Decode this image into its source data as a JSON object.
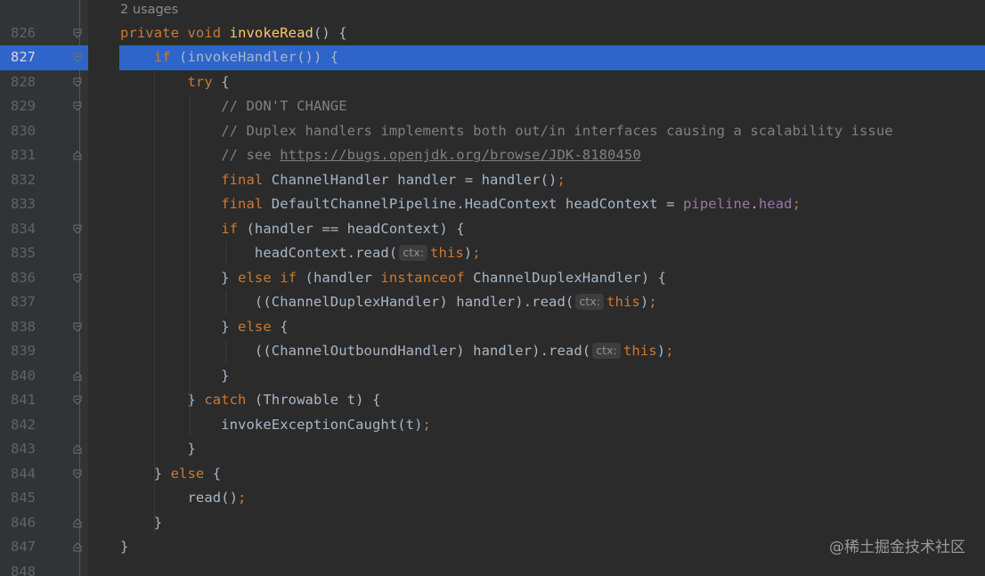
{
  "editor": {
    "usages_hint": "2 usages",
    "current_line": "827",
    "lines": [
      {
        "num": "826",
        "parts": [
          [
            "kw",
            "private "
          ],
          [
            "kw",
            "void "
          ],
          [
            "fn",
            "invokeRead"
          ],
          [
            "plain",
            "() {"
          ]
        ]
      },
      {
        "num": "827",
        "parts": [
          [
            "plain",
            "    "
          ],
          [
            "kw",
            "if "
          ],
          [
            "plain",
            "(invokeHandler()) {"
          ]
        ]
      },
      {
        "num": "828",
        "parts": [
          [
            "plain",
            "        "
          ],
          [
            "kw",
            "try "
          ],
          [
            "plain",
            "{"
          ]
        ]
      },
      {
        "num": "829",
        "parts": [
          [
            "plain",
            "            "
          ],
          [
            "cm",
            "// DON'T CHANGE"
          ]
        ]
      },
      {
        "num": "830",
        "parts": [
          [
            "plain",
            "            "
          ],
          [
            "cm",
            "// Duplex handlers implements both out/in interfaces causing a scalability issue"
          ]
        ]
      },
      {
        "num": "831",
        "parts": [
          [
            "plain",
            "            "
          ],
          [
            "cm",
            "// see "
          ],
          [
            "link",
            "https://bugs.openjdk.org/browse/JDK-8180450"
          ]
        ]
      },
      {
        "num": "832",
        "parts": [
          [
            "plain",
            "            "
          ],
          [
            "kw",
            "final "
          ],
          [
            "plain",
            "ChannelHandler handler = handler()"
          ],
          [
            "kw",
            ";"
          ]
        ]
      },
      {
        "num": "833",
        "parts": [
          [
            "plain",
            "            "
          ],
          [
            "kw",
            "final "
          ],
          [
            "plain",
            "DefaultChannelPipeline.HeadContext headContext = "
          ],
          [
            "field",
            "pipeline"
          ],
          [
            "plain",
            "."
          ],
          [
            "field",
            "head"
          ],
          [
            "kw",
            ";"
          ]
        ]
      },
      {
        "num": "834",
        "parts": [
          [
            "plain",
            "            "
          ],
          [
            "kw",
            "if "
          ],
          [
            "plain",
            "(handler == headContext) {"
          ]
        ]
      },
      {
        "num": "835",
        "parts": [
          [
            "plain",
            "                headContext.read("
          ],
          [
            "hint",
            "ctx:"
          ],
          [
            "kw",
            "this"
          ],
          [
            "plain",
            ")"
          ],
          [
            "kw",
            ";"
          ]
        ]
      },
      {
        "num": "836",
        "parts": [
          [
            "plain",
            "            } "
          ],
          [
            "kw",
            "else if "
          ],
          [
            "plain",
            "(handler "
          ],
          [
            "kw",
            "instanceof "
          ],
          [
            "plain",
            "ChannelDuplexHandler) {"
          ]
        ]
      },
      {
        "num": "837",
        "parts": [
          [
            "plain",
            "                ((ChannelDuplexHandler) handler).read("
          ],
          [
            "hint",
            "ctx:"
          ],
          [
            "kw",
            "this"
          ],
          [
            "plain",
            ")"
          ],
          [
            "kw",
            ";"
          ]
        ]
      },
      {
        "num": "838",
        "parts": [
          [
            "plain",
            "            } "
          ],
          [
            "kw",
            "else "
          ],
          [
            "plain",
            "{"
          ]
        ]
      },
      {
        "num": "839",
        "parts": [
          [
            "plain",
            "                ((ChannelOutboundHandler) handler).read("
          ],
          [
            "hint",
            "ctx:"
          ],
          [
            "kw",
            "this"
          ],
          [
            "plain",
            ")"
          ],
          [
            "kw",
            ";"
          ]
        ]
      },
      {
        "num": "840",
        "parts": [
          [
            "plain",
            "            }"
          ]
        ]
      },
      {
        "num": "841",
        "parts": [
          [
            "plain",
            "        } "
          ],
          [
            "kw",
            "catch "
          ],
          [
            "plain",
            "(Throwable t) {"
          ]
        ]
      },
      {
        "num": "842",
        "parts": [
          [
            "plain",
            "            invokeExceptionCaught(t)"
          ],
          [
            "kw",
            ";"
          ]
        ]
      },
      {
        "num": "843",
        "parts": [
          [
            "plain",
            "        }"
          ]
        ]
      },
      {
        "num": "844",
        "parts": [
          [
            "plain",
            "    } "
          ],
          [
            "kw",
            "else "
          ],
          [
            "plain",
            "{"
          ]
        ]
      },
      {
        "num": "845",
        "parts": [
          [
            "plain",
            "        read()"
          ],
          [
            "kw",
            ";"
          ]
        ]
      },
      {
        "num": "846",
        "parts": [
          [
            "plain",
            "    }"
          ]
        ]
      },
      {
        "num": "847",
        "parts": [
          [
            "plain",
            "}"
          ]
        ]
      },
      {
        "num": "848",
        "parts": []
      }
    ]
  },
  "watermark": "@稀土掘金技术社区",
  "colors": {
    "background": "#2b2b2b",
    "gutter": "#313335",
    "current_line_highlight": "#2f65ca",
    "keyword": "#cc7832",
    "method": "#ffc66d",
    "comment": "#808080",
    "field": "#9876aa",
    "text": "#a9b7c6"
  }
}
